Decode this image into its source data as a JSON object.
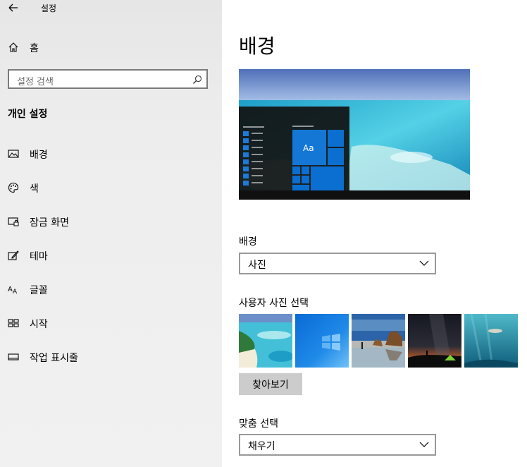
{
  "window": {
    "title": "설정"
  },
  "sidebar": {
    "home_label": "홈",
    "search_placeholder": "설정 검색",
    "section_title": "개인 설정",
    "items": [
      {
        "label": "배경",
        "icon": "image-icon"
      },
      {
        "label": "색",
        "icon": "palette-icon"
      },
      {
        "label": "잠금 화면",
        "icon": "lock-screen-icon"
      },
      {
        "label": "테마",
        "icon": "theme-icon"
      },
      {
        "label": "글꼴",
        "icon": "font-icon"
      },
      {
        "label": "시작",
        "icon": "start-icon"
      },
      {
        "label": "작업 표시줄",
        "icon": "taskbar-icon"
      }
    ]
  },
  "main": {
    "title": "배경",
    "preview": {
      "tile_text": "Aa"
    },
    "background_label": "배경",
    "background_value": "사진",
    "choose_photo_label": "사용자 사진 선택",
    "browse_label": "찾아보기",
    "fit_label": "맞춤 선택",
    "fit_value": "채우기"
  },
  "colors": {
    "accent": "#0078d7",
    "sidebar_bg": "#ececec"
  }
}
